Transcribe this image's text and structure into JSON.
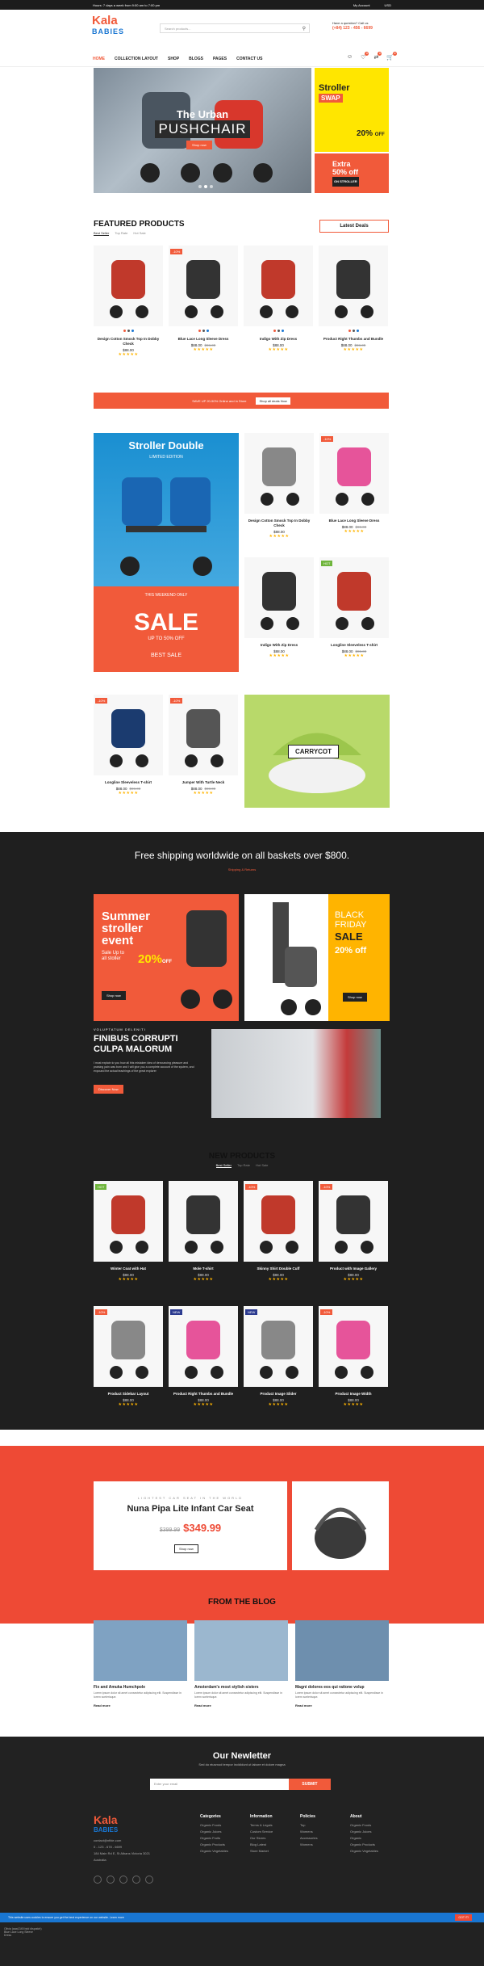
{
  "topbar": {
    "promo": "Hours: 7 days a week from 9:00 am to 7:00 pm",
    "account": "My Account",
    "currency": "USD"
  },
  "header": {
    "logo_top": "Kala",
    "logo_bottom": "BABIES",
    "search_placeholder": "Search products...",
    "help": "Have a question? Call us",
    "phone": "(+84) 123 - 456 - 6699"
  },
  "nav": {
    "items": [
      "HOME",
      "COLLECTION LAYOUT",
      "SHOP",
      "BLOGS",
      "PAGES",
      "CONTACT US"
    ],
    "wishlist_count": "0",
    "compare_count": "0",
    "cart_count": "0"
  },
  "hero": {
    "title_1": "The Urban",
    "title_2": "PUSHCHAIR",
    "button": "Shop now"
  },
  "side_banner_1": {
    "l1": "Stroller",
    "l2": "SWAP",
    "big": "20%",
    "small": "OFF"
  },
  "side_banner_2": {
    "l1": "Extra",
    "l2": "50% off",
    "tag": "ON STROLLER"
  },
  "featured": {
    "title": "FEATURED PRODUCTS",
    "tabs": [
      "Best Seller",
      "Top Rate",
      "Hot Sale"
    ],
    "deals": "Latest Deals",
    "products": [
      {
        "name": "Design Cotton Smock Top In Dobby Check",
        "price": "$88.00",
        "old": "",
        "badge": ""
      },
      {
        "name": "Blue Lace Long Sleeve Dress",
        "price": "$88.00",
        "old": "$98.00",
        "badge": "-10%"
      },
      {
        "name": "Indigo With Zip Dress",
        "price": "$88.00",
        "old": "",
        "badge": ""
      },
      {
        "name": "Product Right Thumbs and Bundle",
        "price": "$88.00",
        "old": "$98.00",
        "badge": ""
      }
    ]
  },
  "strip": {
    "text": "SAVE UP 20-50% Online and in Store",
    "button": "Shop all deals Now"
  },
  "stroller_double": {
    "title": "Stroller Double",
    "sub": "LIMITED EDITION",
    "weekend": "THIS WEEKEND ONLY",
    "sale": "SALE",
    "off": "UP TO 50% OFF",
    "best": "BEST SALE"
  },
  "grid_products": [
    {
      "name": "Design Cotton Smock Top In Dobby Check",
      "price": "$88.00",
      "old": "",
      "badge": ""
    },
    {
      "name": "Blue Lace Long Sleeve Dress",
      "price": "$88.00",
      "old": "$98.00",
      "badge": "-10%"
    },
    {
      "name": "Indigo With Zip Dress",
      "price": "$88.00",
      "old": "",
      "badge": ""
    },
    {
      "name": "Longline Sleeveless T-shirt",
      "price": "$88.00",
      "old": "$98.00",
      "badge": "HOT"
    },
    {
      "name": "Longline Sleeveless T-shirt",
      "price": "$88.00",
      "old": "$98.00",
      "badge": "-10%"
    },
    {
      "name": "Jumper With Turtle Neck",
      "price": "$88.00",
      "old": "$98.00",
      "badge": "-10%"
    }
  ],
  "carrycot": "CARRYCOT",
  "dark": {
    "shipping": "Free shipping worldwide on all baskets over $800.",
    "shipping_link": "Shipping & Returns"
  },
  "summer": {
    "l1": "Summer",
    "l2": "stroller",
    "l3": "event",
    "upto": "Sale Up to",
    "all": "all stoller",
    "pct": "20%",
    "off": "OFF",
    "btn": "Shop now"
  },
  "blackfriday": {
    "l1": "BLACK",
    "l2": "FRIDAY",
    "l3": "SALE",
    "pct": "20% off",
    "btn": "Shop now"
  },
  "finibus": {
    "kicker": "VOLUPTATUM DELENITI",
    "title": "FINIBUS CORRUPTI CULPA MALORUM",
    "desc": "I must explain to you how all this mistaken idea of denouncing pleasure and praising pain was born and I will give you a complete account of the system, and expound the actual teachings of the great explorer",
    "btn": "Discover Now"
  },
  "new_products": {
    "title": "NEW PRODUCTS",
    "tabs": [
      "Best Seller",
      "Top Rate",
      "Hot Sale"
    ],
    "items": [
      {
        "name": "Winter Coat with Hat",
        "price": "$88.00",
        "badge": "HOT"
      },
      {
        "name": "Mole T-shirt",
        "price": "$88.00",
        "badge": ""
      },
      {
        "name": "Skinny Shirt Double Cuff",
        "price": "$88.00",
        "badge": "-10%"
      },
      {
        "name": "Product with Image Gallery",
        "price": "$88.00",
        "badge": "-10%"
      },
      {
        "name": "Product Sidebar Layout",
        "price": "$88.00",
        "badge": "-10%"
      },
      {
        "name": "Product Right Thumbs and Bundle",
        "price": "$88.00",
        "badge": "NEW"
      },
      {
        "name": "Product Image Slider",
        "price": "$88.00",
        "badge": "NEW"
      },
      {
        "name": "Product Image Width",
        "price": "$88.00",
        "badge": "-10%"
      }
    ]
  },
  "car_seat": {
    "sub": "LIGHTEST CAR SEAT IN THE WORLD",
    "title": "Nuna Pipa Lite Infant Car Seat",
    "old": "$399.99",
    "price": "$349.99",
    "btn": "Shop now"
  },
  "blog": {
    "title": "FROM THE BLOG",
    "posts": [
      {
        "title": "Fix and Amuka Humchpole",
        "desc": "Lorem ipsum dolor sit amet consectetur adipiscing elit. Suspendisse in lorem scelerisque.",
        "more": "Read more"
      },
      {
        "title": "Amsterdam's most stylish sisters",
        "desc": "Lorem ipsum dolor sit amet consectetur adipiscing elit. Suspendisse in lorem scelerisque.",
        "more": "Read more"
      },
      {
        "title": "Magni dolores eos qui ratione volup",
        "desc": "Lorem ipsum dolor sit amet consectetur adipiscing elit. Suspendisse in lorem scelerisque.",
        "more": "Read more"
      }
    ]
  },
  "newsletter": {
    "title": "Our Newletter",
    "sub": "Sed do eiusmod tempor incididunt ut labore et dolore magna",
    "placeholder": "Enter your email",
    "btn": "SUBMIT"
  },
  "footer": {
    "contact": [
      "contact@nfbie.com",
      "0 - 123 - 678 - 6699",
      "184 Main Rd E, St Albans Victoria 3021 Australia"
    ],
    "cols": [
      {
        "h": "Categories",
        "items": [
          "Organic Foods",
          "Organic Juices",
          "Organic Fruits",
          "Organic Products",
          "Organic Vegetables"
        ]
      },
      {
        "h": "Information",
        "items": [
          "Terms & Legals",
          "Custom Service",
          "Our Stores",
          "Blog Latest",
          "Store Market"
        ]
      },
      {
        "h": "Policies",
        "items": [
          "Top",
          "Womens",
          "Accessories",
          "Womens"
        ]
      },
      {
        "h": "About",
        "items": [
          "Organic Foods",
          "Organic Juices",
          "Organic",
          "Organic Products",
          "Organic Vegetables"
        ]
      }
    ]
  },
  "cookie": {
    "text": "This website uses cookies to ensure you get the best experience on our website. Learn more",
    "btn": "GOT IT!"
  },
  "toast": {
    "l1": "Olivia (aaa1345 bdd dispatch)",
    "l2": "Blue Lace Long Sleeve",
    "l3": "Dress"
  },
  "colors": {
    "accent": "#f15a3a",
    "dark": "#1f1f1f",
    "yellow": "#ffe600",
    "blue": "#1976d2"
  }
}
